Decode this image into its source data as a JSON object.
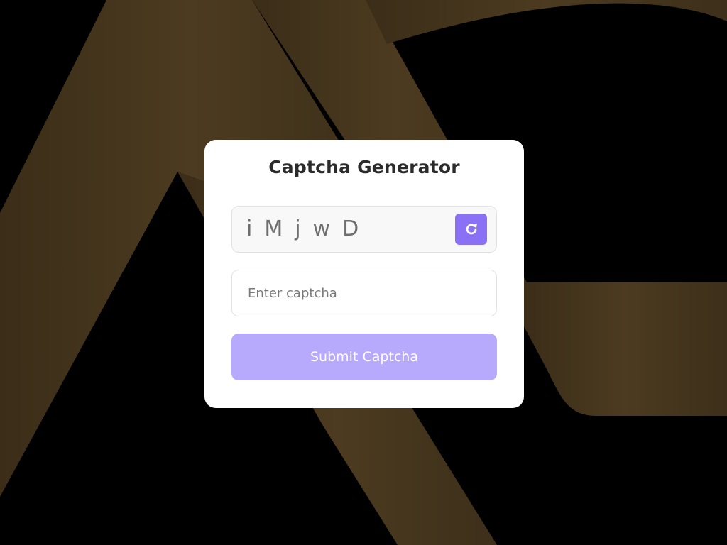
{
  "app": {
    "title": "Captcha Generator"
  },
  "captcha": {
    "code": "iMjwD",
    "refresh_icon": "refresh-icon"
  },
  "input": {
    "value": "",
    "placeholder": "Enter captcha"
  },
  "submit": {
    "label": "Submit Captcha"
  },
  "colors": {
    "accent": "#8a70f5",
    "submit_disabled": "#b7a9fb",
    "background": "#000000",
    "background_logo": "#4a391f",
    "card": "#ffffff"
  }
}
